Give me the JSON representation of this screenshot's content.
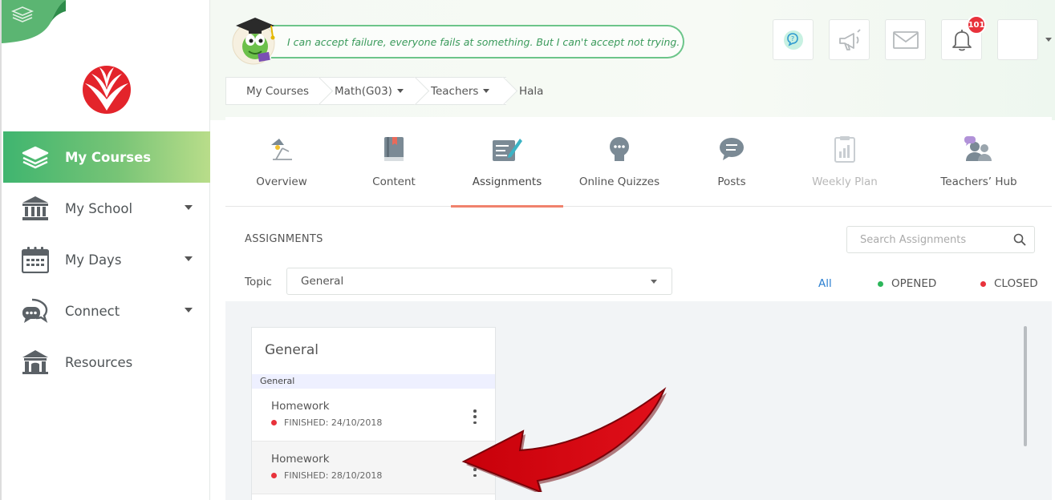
{
  "quote": "I can accept failure, everyone fails at something. But I can't accept not trying.",
  "notifications": {
    "count": "101"
  },
  "sidebar": {
    "items": [
      {
        "label": "My Courses",
        "icon": "layers-icon",
        "active": true
      },
      {
        "label": "My School",
        "icon": "building-icon"
      },
      {
        "label": "My Days",
        "icon": "calendar-icon"
      },
      {
        "label": "Connect",
        "icon": "chat-bubbles-icon"
      },
      {
        "label": "Resources",
        "icon": "library-icon"
      }
    ]
  },
  "breadcrumb": [
    "My Courses",
    "Math(G03)",
    "Teachers",
    "Hala"
  ],
  "tabs": [
    {
      "label": "Overview",
      "icon": "lamp-icon"
    },
    {
      "label": "Content",
      "icon": "book-icon"
    },
    {
      "label": "Assignments",
      "icon": "assignment-icon",
      "active": true
    },
    {
      "label": "Online Quizzes",
      "icon": "quiz-icon"
    },
    {
      "label": "Posts",
      "icon": "speech-bubble-icon"
    },
    {
      "label": "Weekly Plan",
      "icon": "weekly-plan-icon",
      "disabled": true
    },
    {
      "label": "Teachers’ Hub",
      "icon": "people-icon"
    }
  ],
  "assignments": {
    "section_title": "ASSIGNMENTS",
    "search_placeholder": "Search Assignments",
    "topic_label": "Topic",
    "topic_value": "General",
    "filters": {
      "all": "All",
      "opened": "OPENED",
      "closed": "CLOSED"
    },
    "colors": {
      "opened": "#2cb65a",
      "closed": "#e8323b",
      "accent": "#f0826d",
      "all": "#2b7fd1"
    },
    "card": {
      "title": "General",
      "subheader": "General",
      "items": [
        {
          "name": "Homework",
          "status": "FINISHED: 24/10/2018"
        },
        {
          "name": "Homework",
          "status": "FINISHED: 28/10/2018"
        }
      ]
    }
  }
}
